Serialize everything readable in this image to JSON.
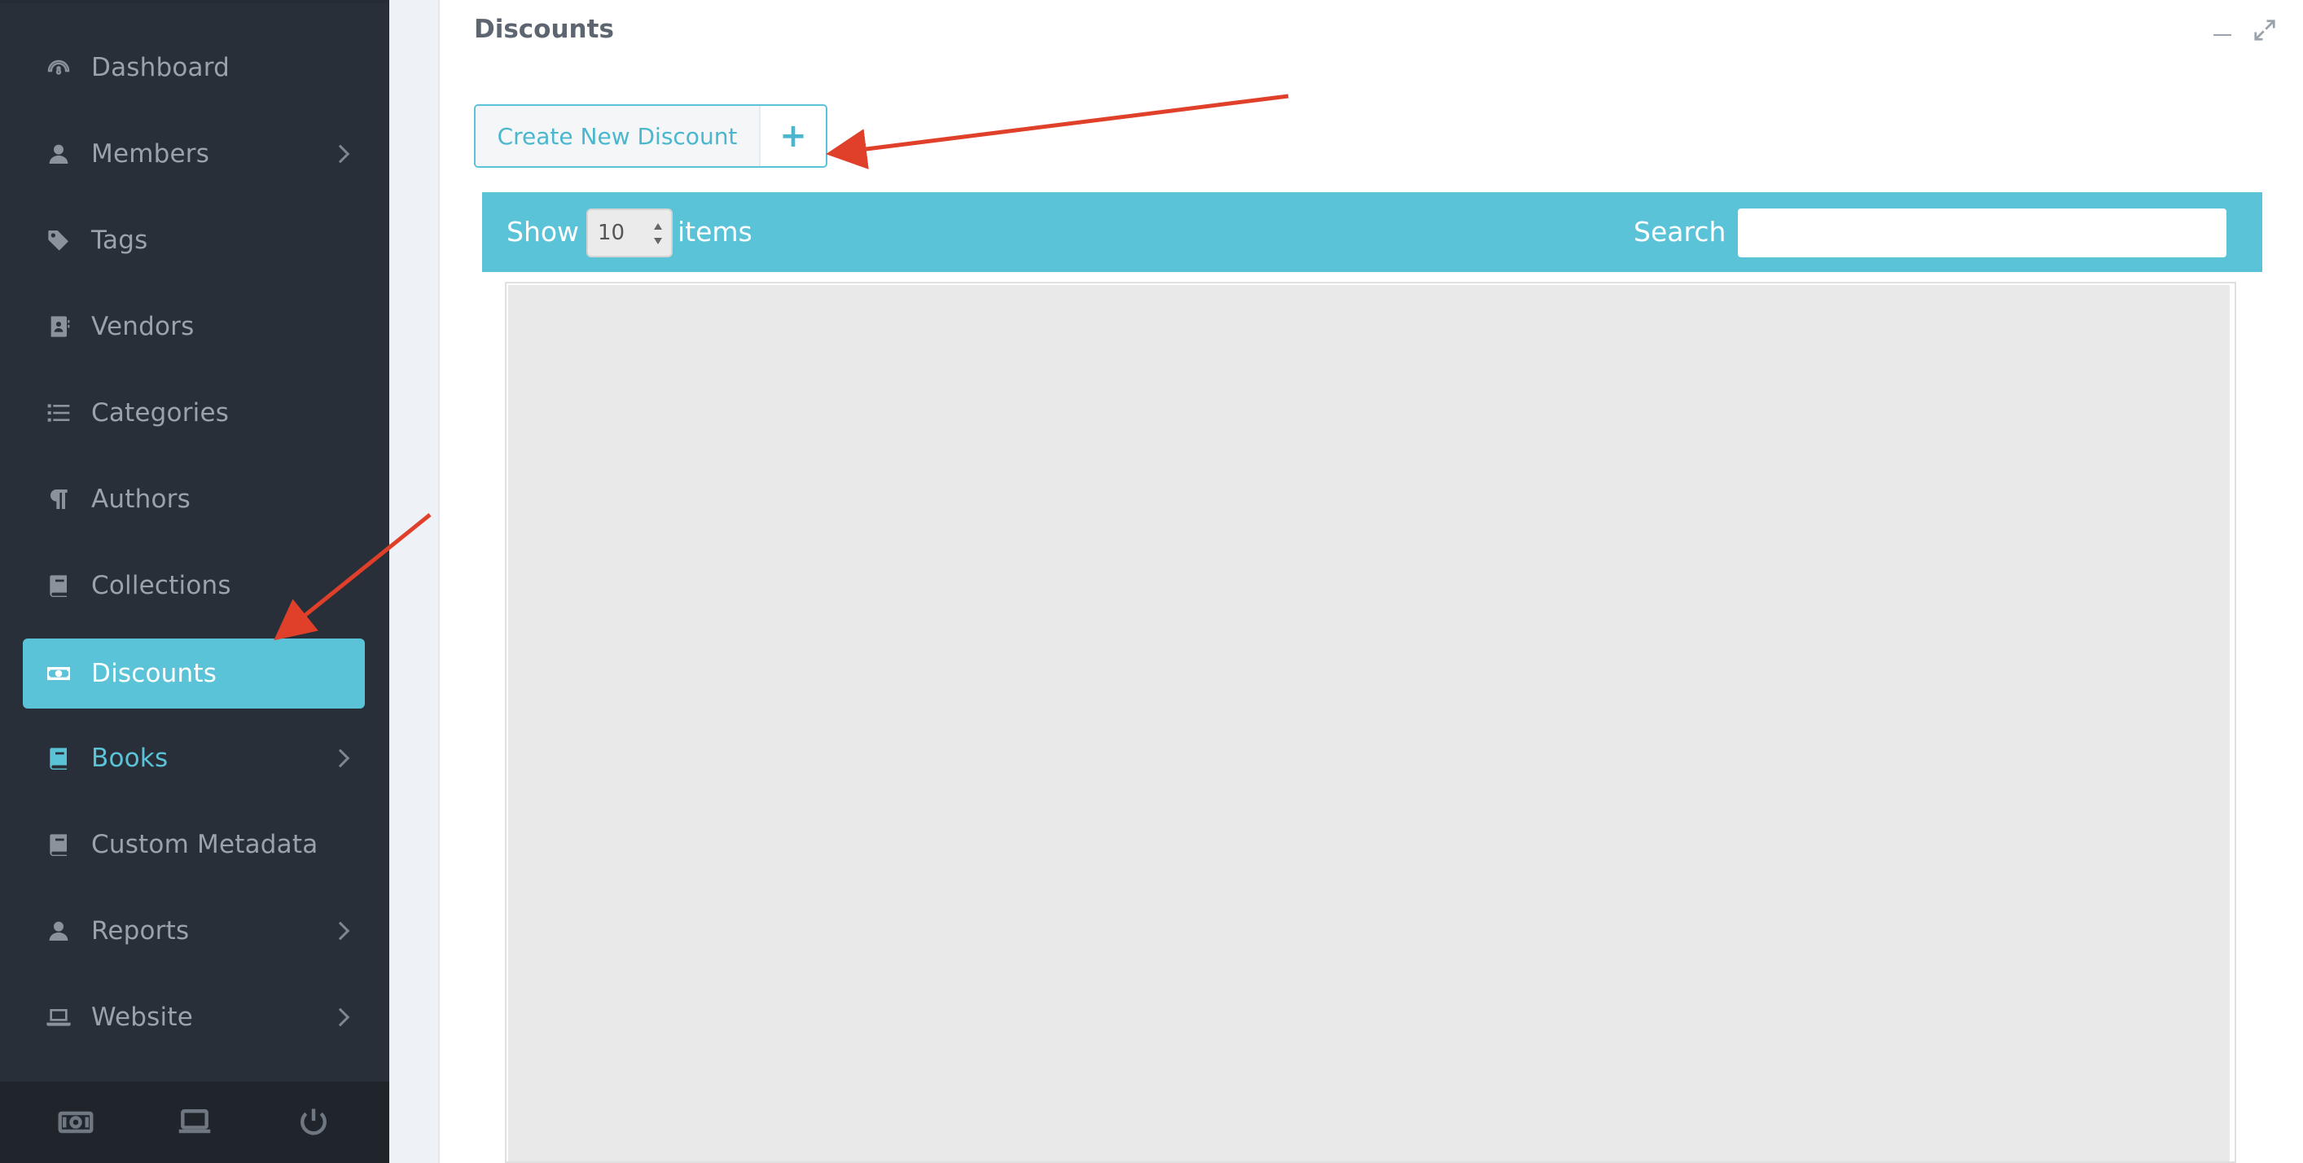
{
  "sidebar": {
    "items": [
      {
        "label": "Dashboard",
        "icon": "dashboard-gauge-icon",
        "has_submenu": false,
        "state": "normal"
      },
      {
        "label": "Members",
        "icon": "user-icon",
        "has_submenu": true,
        "state": "normal"
      },
      {
        "label": "Tags",
        "icon": "tag-icon",
        "has_submenu": false,
        "state": "normal"
      },
      {
        "label": "Vendors",
        "icon": "address-book-icon",
        "has_submenu": false,
        "state": "normal"
      },
      {
        "label": "Categories",
        "icon": "list-icon",
        "has_submenu": false,
        "state": "normal"
      },
      {
        "label": "Authors",
        "icon": "paragraph-icon",
        "has_submenu": false,
        "state": "normal"
      },
      {
        "label": "Collections",
        "icon": "book-icon",
        "has_submenu": false,
        "state": "normal"
      },
      {
        "label": "Discounts",
        "icon": "money-bill-icon",
        "has_submenu": false,
        "state": "active"
      },
      {
        "label": "Books",
        "icon": "book-icon",
        "has_submenu": true,
        "state": "highlight"
      },
      {
        "label": "Custom Metadata",
        "icon": "book-icon",
        "has_submenu": false,
        "state": "normal"
      },
      {
        "label": "Reports",
        "icon": "user-icon",
        "has_submenu": true,
        "state": "normal"
      },
      {
        "label": "Website",
        "icon": "laptop-icon",
        "has_submenu": true,
        "state": "normal"
      }
    ],
    "footer_icons": [
      "money-bill-icon",
      "laptop-icon",
      "power-icon"
    ]
  },
  "page": {
    "title": "Discounts",
    "create_button_label": "Create New Discount",
    "create_button_icon": "+"
  },
  "table_controls": {
    "show_label": "Show",
    "page_size": "10",
    "items_label": "items",
    "search_label": "Search",
    "search_value": ""
  },
  "colors": {
    "accent": "#5bc3d8",
    "sidebar_bg": "#292f38",
    "annotation_arrow": "#e0402a"
  }
}
